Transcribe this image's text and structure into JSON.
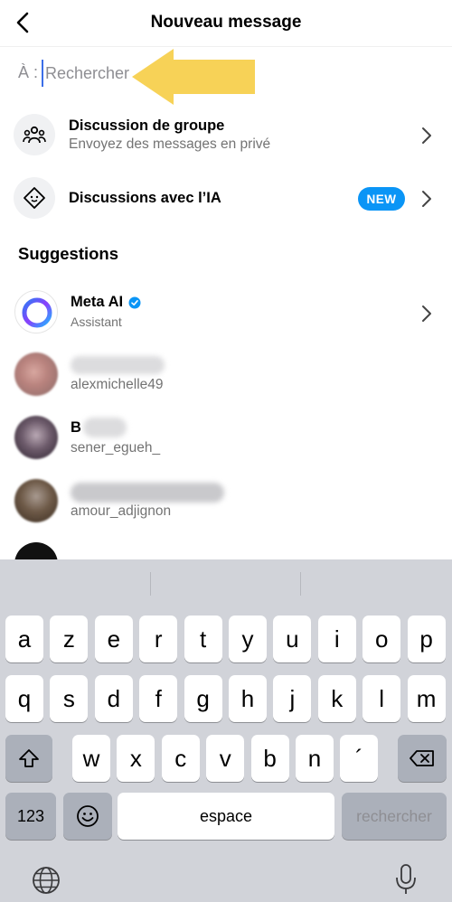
{
  "header": {
    "title": "Nouveau message"
  },
  "search": {
    "prefix": "À :",
    "placeholder": "Rechercher"
  },
  "options": [
    {
      "title": "Discussion de groupe",
      "subtitle": "Envoyez des messages en privé",
      "icon": "group-icon"
    },
    {
      "title": "Discussions avec l’IA",
      "badge": "NEW",
      "icon": "ai-icon"
    }
  ],
  "suggestions_title": "Suggestions",
  "suggestions": [
    {
      "name": "Meta AI",
      "verified": true,
      "handle": "Assistant",
      "avatar_color": "#5b6cf6"
    },
    {
      "name": "",
      "handle": "alexmichelle49"
    },
    {
      "name": "B",
      "handle": "sener_egueh_"
    },
    {
      "name": "",
      "handle": "amour_adjignon"
    }
  ],
  "keyboard": {
    "row1": [
      "a",
      "z",
      "e",
      "r",
      "t",
      "y",
      "u",
      "i",
      "o",
      "p"
    ],
    "row2": [
      "q",
      "s",
      "d",
      "f",
      "g",
      "h",
      "j",
      "k",
      "l",
      "m"
    ],
    "row3": [
      "w",
      "x",
      "c",
      "v",
      "b",
      "n",
      "´"
    ],
    "numbers_key": "123",
    "space_key": "espace",
    "search_key": "rechercher"
  },
  "colors": {
    "accent": "#0a95f6",
    "verified": "#0a95f6",
    "arrow": "#f7d04e",
    "keyboard_bg": "#d1d3d9"
  }
}
